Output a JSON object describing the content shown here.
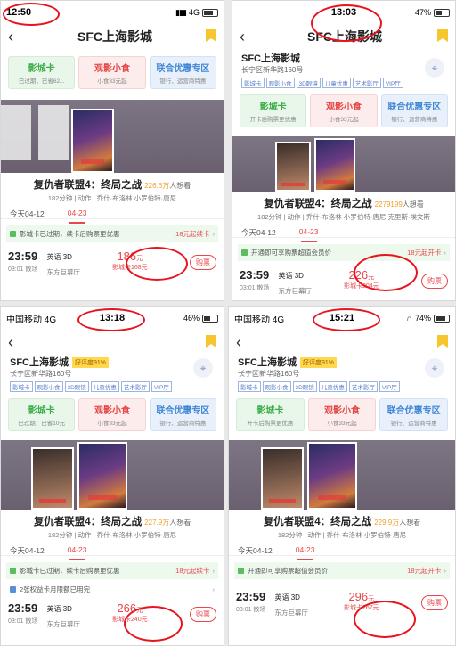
{
  "panels": [
    {
      "status": {
        "left": "12:50",
        "center": "",
        "right": "4G"
      },
      "title": "SFC上海影城",
      "cards": [
        {
          "title": "影城卡",
          "sub": "已过期，已省62..."
        },
        {
          "title": "观影小食",
          "sub": "小食33元起"
        },
        {
          "title": "联合优惠专区",
          "sub": "银行、运营商特惠"
        }
      ],
      "movie": {
        "title": "复仇者联盟4：终局之战",
        "wish": "226.6万",
        "wish_label": "人想看",
        "meta": "182分钟 | 动作 | 乔什·布洛林 小罗伯特·唐尼"
      },
      "dates": [
        "今天04-12",
        "04-23"
      ],
      "notice": {
        "text": "影城卡已过期，续卡后购票更优惠",
        "action": "18元起续卡",
        "arrow": "›"
      },
      "show": {
        "time": "23:59",
        "end": "03:01 散场",
        "version": "英语 3D",
        "hall": "东方巨幕厅",
        "price": "186",
        "unit": "元",
        "card_price": "影城卡168元",
        "buy": "购票"
      }
    },
    {
      "status": {
        "left": "",
        "center": "13:03",
        "right": "47%"
      },
      "title": "SFC上海影城",
      "address": "长宁区新华路160号",
      "tags": [
        "影城卡",
        "观影小食",
        "3D眼镜",
        "儿童优惠",
        "艺术影厅",
        "VIP厅"
      ],
      "cards": [
        {
          "title": "影城卡",
          "sub": "开卡后购票更优惠"
        },
        {
          "title": "观影小食",
          "sub": "小食33元起"
        },
        {
          "title": "联合优惠专区",
          "sub": "银行、运营商特惠"
        }
      ],
      "movie": {
        "title": "复仇者联盟4：终局之战",
        "wish": "2279199",
        "wish_label": "人想看",
        "meta": "182分钟 | 动作 | 乔什·布洛林 小罗伯特·唐尼 克里斯·埃文斯"
      },
      "dates": [
        "今天04-12",
        "04-23"
      ],
      "notice": {
        "text": "开通即可享购票超值会员价",
        "action": "18元起开卡",
        "arrow": "›"
      },
      "show": {
        "time": "23:59",
        "end": "03:01 散场",
        "version": "英语 3D",
        "hall": "东方巨幕厅",
        "price": "226",
        "unit": "元",
        "card_price": "影城卡204元",
        "buy": "购票"
      }
    },
    {
      "status": {
        "left": "中国移动 4G",
        "center": "13:18",
        "right": "46%"
      },
      "title": "SFC上海影城",
      "rating": "好评度91%",
      "address": "长宁区新华路160号",
      "tags": [
        "影城卡",
        "观影小食",
        "3D眼镜",
        "儿童优惠",
        "艺术影厅",
        "VIP厅"
      ],
      "cards": [
        {
          "title": "影城卡",
          "sub": "已过期，已省10元"
        },
        {
          "title": "观影小食",
          "sub": "小食33元起"
        },
        {
          "title": "联合优惠专区",
          "sub": "银行、运营商特惠"
        }
      ],
      "movie": {
        "title": "复仇者联盟4：终局之战",
        "wish": "227.9万",
        "wish_label": "人想看",
        "meta": "182分钟 | 动作 | 乔什·布洛林 小罗伯特·唐尼"
      },
      "dates": [
        "今天04-12",
        "04-23"
      ],
      "notice": {
        "text": "影城卡已过期，续卡后购票更优惠",
        "action": "18元起续卡",
        "arrow": "›"
      },
      "notice2": {
        "text": "2张权益卡月限额已用完",
        "arrow": "›"
      },
      "show": {
        "time": "23:59",
        "end": "03:01 散场",
        "version": "英语 3D",
        "hall": "东方巨幕厅",
        "price": "266",
        "unit": "元",
        "card_price": "影城卡240元",
        "buy": "购票"
      }
    },
    {
      "status": {
        "left": "中国移动 4G",
        "center": "15:21",
        "right": "74%"
      },
      "title": "SFC上海影城",
      "rating": "好评度91%",
      "address": "长宁区新华路160号",
      "tags": [
        "影城卡",
        "观影小食",
        "3D眼镜",
        "儿童优惠",
        "艺术影厅",
        "VIP厅"
      ],
      "cards": [
        {
          "title": "影城卡",
          "sub": "开卡后购票更优惠"
        },
        {
          "title": "观影小食",
          "sub": "小食33元起"
        },
        {
          "title": "联合优惠专区",
          "sub": "银行、运营商特惠"
        }
      ],
      "movie": {
        "title": "复仇者联盟4：终局之战",
        "wish": "229.9万",
        "wish_label": "人想看",
        "meta": "182分钟 | 动作 | 乔什·布洛林 小罗伯特·唐尼"
      },
      "dates": [
        "今天04-12",
        "04-23"
      ],
      "notice": {
        "text": "开通即可享购票超值会员价",
        "action": "18元起开卡",
        "arrow": "›"
      },
      "show": {
        "time": "23:59",
        "end": "03:01 散场",
        "version": "英语 3D",
        "hall": "东方巨幕厅",
        "price": "296",
        "unit": "元",
        "card_price": "影城卡267元",
        "buy": "购票"
      }
    }
  ],
  "colors": {
    "accent": "#e8474c",
    "highlight_circle": "#e8141d",
    "favorite": "#f7c62f"
  }
}
